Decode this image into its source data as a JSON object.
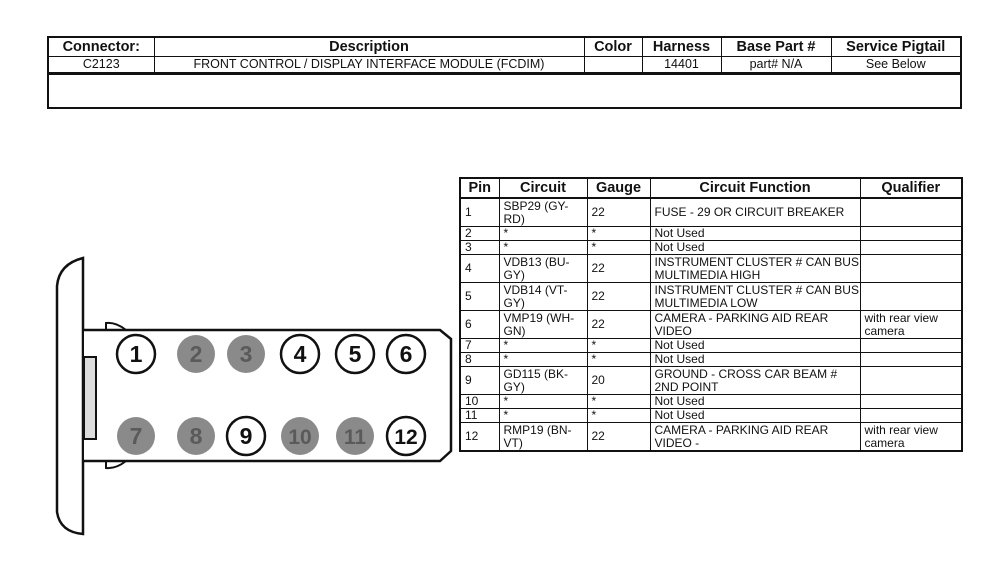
{
  "connector_header": {
    "columns": [
      "Connector:",
      "Description",
      "Color",
      "Harness",
      "Base Part #",
      "Service Pigtail"
    ],
    "row": {
      "connector": "C2123",
      "description": "FRONT CONTROL / DISPLAY INTERFACE MODULE (FCDIM)",
      "color": "",
      "harness": "14401",
      "base_part": "part# N/A",
      "service_pigtail": "See Below"
    },
    "notes": ""
  },
  "pin_table": {
    "columns": [
      "Pin",
      "Circuit",
      "Gauge",
      "Circuit Function",
      "Qualifier"
    ],
    "rows": [
      {
        "pin": "1",
        "circuit": "SBP29 (GY-RD)",
        "gauge": "22",
        "function": "FUSE - 29 OR CIRCUIT BREAKER",
        "qualifier": ""
      },
      {
        "pin": "2",
        "circuit": "*",
        "gauge": "*",
        "function": "Not Used",
        "qualifier": ""
      },
      {
        "pin": "3",
        "circuit": "*",
        "gauge": "*",
        "function": "Not Used",
        "qualifier": ""
      },
      {
        "pin": "4",
        "circuit": "VDB13 (BU-GY)",
        "gauge": "22",
        "function": "INSTRUMENT CLUSTER # CAN BUS MULTIMEDIA HIGH",
        "qualifier": ""
      },
      {
        "pin": "5",
        "circuit": "VDB14 (VT-GY)",
        "gauge": "22",
        "function": "INSTRUMENT CLUSTER # CAN BUS MULTIMEDIA LOW",
        "qualifier": ""
      },
      {
        "pin": "6",
        "circuit": "VMP19 (WH-GN)",
        "gauge": "22",
        "function": "CAMERA - PARKING AID REAR VIDEO",
        "qualifier": "with rear view camera"
      },
      {
        "pin": "7",
        "circuit": "*",
        "gauge": "*",
        "function": "Not Used",
        "qualifier": ""
      },
      {
        "pin": "8",
        "circuit": "*",
        "gauge": "*",
        "function": "Not Used",
        "qualifier": ""
      },
      {
        "pin": "9",
        "circuit": "GD115 (BK-GY)",
        "gauge": "20",
        "function": "GROUND - CROSS CAR BEAM # 2ND POINT",
        "qualifier": ""
      },
      {
        "pin": "10",
        "circuit": "*",
        "gauge": "*",
        "function": "Not Used",
        "qualifier": ""
      },
      {
        "pin": "11",
        "circuit": "*",
        "gauge": "*",
        "function": "Not Used",
        "qualifier": ""
      },
      {
        "pin": "12",
        "circuit": "RMP19 (BN-VT)",
        "gauge": "22",
        "function": "CAMERA - PARKING AID REAR VIDEO -",
        "qualifier": "with rear view camera"
      }
    ]
  },
  "connector_face": {
    "pins": [
      {
        "label": "1",
        "used": true
      },
      {
        "label": "2",
        "used": false
      },
      {
        "label": "3",
        "used": false
      },
      {
        "label": "4",
        "used": true
      },
      {
        "label": "5",
        "used": true
      },
      {
        "label": "6",
        "used": true
      },
      {
        "label": "7",
        "used": false
      },
      {
        "label": "8",
        "used": false
      },
      {
        "label": "9",
        "used": true
      },
      {
        "label": "10",
        "used": false
      },
      {
        "label": "11",
        "used": false
      },
      {
        "label": "12",
        "used": true
      }
    ],
    "colors": {
      "unused_fill": "#8a8a8a",
      "unused_text": "#5a5a5a",
      "used_stroke": "#111111",
      "latch_fill": "#dcdcdc"
    }
  }
}
